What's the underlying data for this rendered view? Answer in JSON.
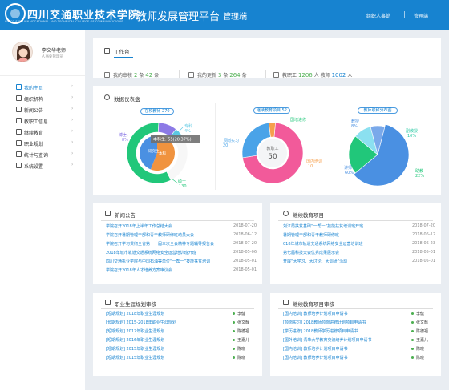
{
  "header": {
    "school_name": "四川交通职业技术学院",
    "school_en": "SICHUAN VOCATIONAL AND TECHNICAL COLLEGE OF COMMUNICATIONS",
    "logo_text": "SVTCC",
    "platform_title": "教师发展管理平台",
    "platform_sub": "管理端",
    "dept_link": "组织人事处",
    "admin_link": "管理端"
  },
  "user": {
    "name": "李文华老师",
    "role": "人事处管理员"
  },
  "menu": [
    {
      "label": "我的主页",
      "icon": "home-icon",
      "active": true
    },
    {
      "label": "组织机构",
      "icon": "org-icon"
    },
    {
      "label": "新闻公告",
      "icon": "news-icon"
    },
    {
      "label": "教职工信息",
      "icon": "staff-icon"
    },
    {
      "label": "继续教育",
      "icon": "education-icon"
    },
    {
      "label": "职业规划",
      "icon": "plan-icon"
    },
    {
      "label": "统计与查询",
      "icon": "stats-icon"
    },
    {
      "label": "系统设置",
      "icon": "settings-icon"
    }
  ],
  "workbench": {
    "title": "工作台",
    "audit": {
      "prefix": "我的审核",
      "n1": "2",
      "unit1": "条",
      "n2": "42",
      "unit2": "条"
    },
    "update": {
      "prefix": "我的更新",
      "n1": "3",
      "unit1": "条",
      "n2": "264",
      "unit2": "条"
    },
    "staff": {
      "label1": "教职工",
      "n1": "1206",
      "unit1": "人",
      "label2": "教师",
      "n2": "1002",
      "unit2": "人"
    }
  },
  "dashboard": {
    "title": "数据仪表盘",
    "donut1_pill": "在校教师",
    "donut1_pill_num": "270",
    "donut1_tooltip": "本科生: 55(20.37%)",
    "donut1_center1": "研究生",
    "donut1_center2": "本科",
    "donut1_labels": {
      "zhuanke": "专科",
      "zhuanke_pct": "4%",
      "boshi": "博士",
      "boshi_pct": "8%",
      "shuoshi": "硕士",
      "shuoshi_pct": "130"
    },
    "donut2_pill": "继续教育项目",
    "donut2_pill_num": "52",
    "donut2_center_label": "教职工",
    "donut2_center_value": "50",
    "donut2_labels": {
      "guopei": "国培进修",
      "guopei_n": "",
      "dingqi": "顶岗实习",
      "dingqi_n": "20",
      "guonei": "国内培训",
      "guonei_n": "10"
    },
    "pie3_pill": "教师职称分布图",
    "pie3_labels": {
      "jiaoshou": "教授",
      "jiaoshou_pct": "8%",
      "fujiaoshou": "副教授",
      "fujiaoshou_pct": "10%",
      "jiangshi": "讲师",
      "jiangshi_pct": "60%",
      "zhujiao": "助教",
      "zhujiao_pct": "22%"
    }
  },
  "chart_data": [
    {
      "type": "pie",
      "title": "在校教师 270",
      "categories": [
        "硕士",
        "本科",
        "博士",
        "专科",
        "研究生"
      ],
      "values": [
        130,
        55,
        22,
        11,
        52
      ],
      "colors": [
        "#21c77a",
        "#f0933f",
        "#8c7ae6",
        "#5bc8e3",
        "#4a90e2"
      ]
    },
    {
      "type": "pie",
      "title": "继续教育项目 52",
      "categories": [
        "国培进修",
        "顶岗实习",
        "国内培训"
      ],
      "values": [
        20,
        20,
        10
      ],
      "colors": [
        "#f25a9a",
        "#4aa3e8",
        "#f6a04d"
      ]
    },
    {
      "type": "pie",
      "title": "教师职称分布图",
      "categories": [
        "讲师",
        "助教",
        "副教授",
        "教授"
      ],
      "values": [
        60,
        22,
        10,
        8
      ],
      "colors": [
        "#4a90e2",
        "#21c77a",
        "#8be0f0",
        "#7aa9ea"
      ]
    }
  ],
  "news": {
    "title": "新闻公告",
    "items": [
      {
        "text": "学院召开2018年上半年工作总结大会",
        "date": "2018-07-20"
      },
      {
        "text": "学院召开暑期管理干部和青干教师研修班动员大会",
        "date": "2018-06-12"
      },
      {
        "text": "学院召开学习贯彻全省第十一届三次全会精神专题辅导报告会",
        "date": "2018-07-20"
      },
      {
        "text": "2018年城市轨道交通系统网络安全运营培训班开班",
        "date": "2018-05-06"
      },
      {
        "text": "四川交通执业学院与中国石油等单位“一帮一”技能扶贫培训",
        "date": "2018-05-01"
      },
      {
        "text": "学院召开2018年人才培养方案审议会",
        "date": "2018-05-01"
      }
    ]
  },
  "continuing": {
    "title": "继续教育项目",
    "items": [
      {
        "text": "刘江局扶贫基础“一帮一”技能扶贫培训班开班",
        "date": "2018-07-20"
      },
      {
        "text": "暑期管理干部和青干教师研修班",
        "date": "2018-06-12"
      },
      {
        "text": "018年城市轨道交通系统网络安全运营培训班",
        "date": "2018-06-23"
      },
      {
        "text": "第七届科技大会优秀成果展示会",
        "date": "2018-05-01"
      },
      {
        "text": "开展“大学习、大讨论、大调研”活动",
        "date": "2018-05-01"
      }
    ]
  },
  "career": {
    "title": "职业生涯规划审核",
    "items": [
      {
        "text": "[短期规划] 2018年职业生涯规划",
        "name": "李健"
      },
      {
        "text": "[长期规划] 2015-2018年职业生涯规划",
        "name": "张文辉"
      },
      {
        "text": "[短期规划] 2017年职业生涯规划",
        "name": "陈德福"
      },
      {
        "text": "[短期规划] 2016年职业生涯规划",
        "name": "王嘉儿"
      },
      {
        "text": "[短期规划] 2015年职业生涯规划",
        "name": "陈晓"
      },
      {
        "text": "[短期规划] 2015年职业生涯规划",
        "name": "陈晓"
      }
    ]
  },
  "cont_audit": {
    "title": "继续教育项目审核",
    "items": [
      {
        "text": "[国内培训] 教师培养计划项目申请书",
        "name": "李健"
      },
      {
        "text": "[顶岗实习] 2018教师顶岗进修计划项目申请书",
        "name": "张文辉"
      },
      {
        "text": "[学历进修] 2018教师学历进修项目申请书",
        "name": "陈德福"
      },
      {
        "text": "[国外培训] 清华大学教育交流培养计划项目申请书",
        "name": "王嘉儿"
      },
      {
        "text": "[国内培训] 教师培养计划项目申请书",
        "name": "陈晓"
      },
      {
        "text": "[国内培训] 教师培养计划项目申请书",
        "name": "陈晓"
      }
    ]
  }
}
